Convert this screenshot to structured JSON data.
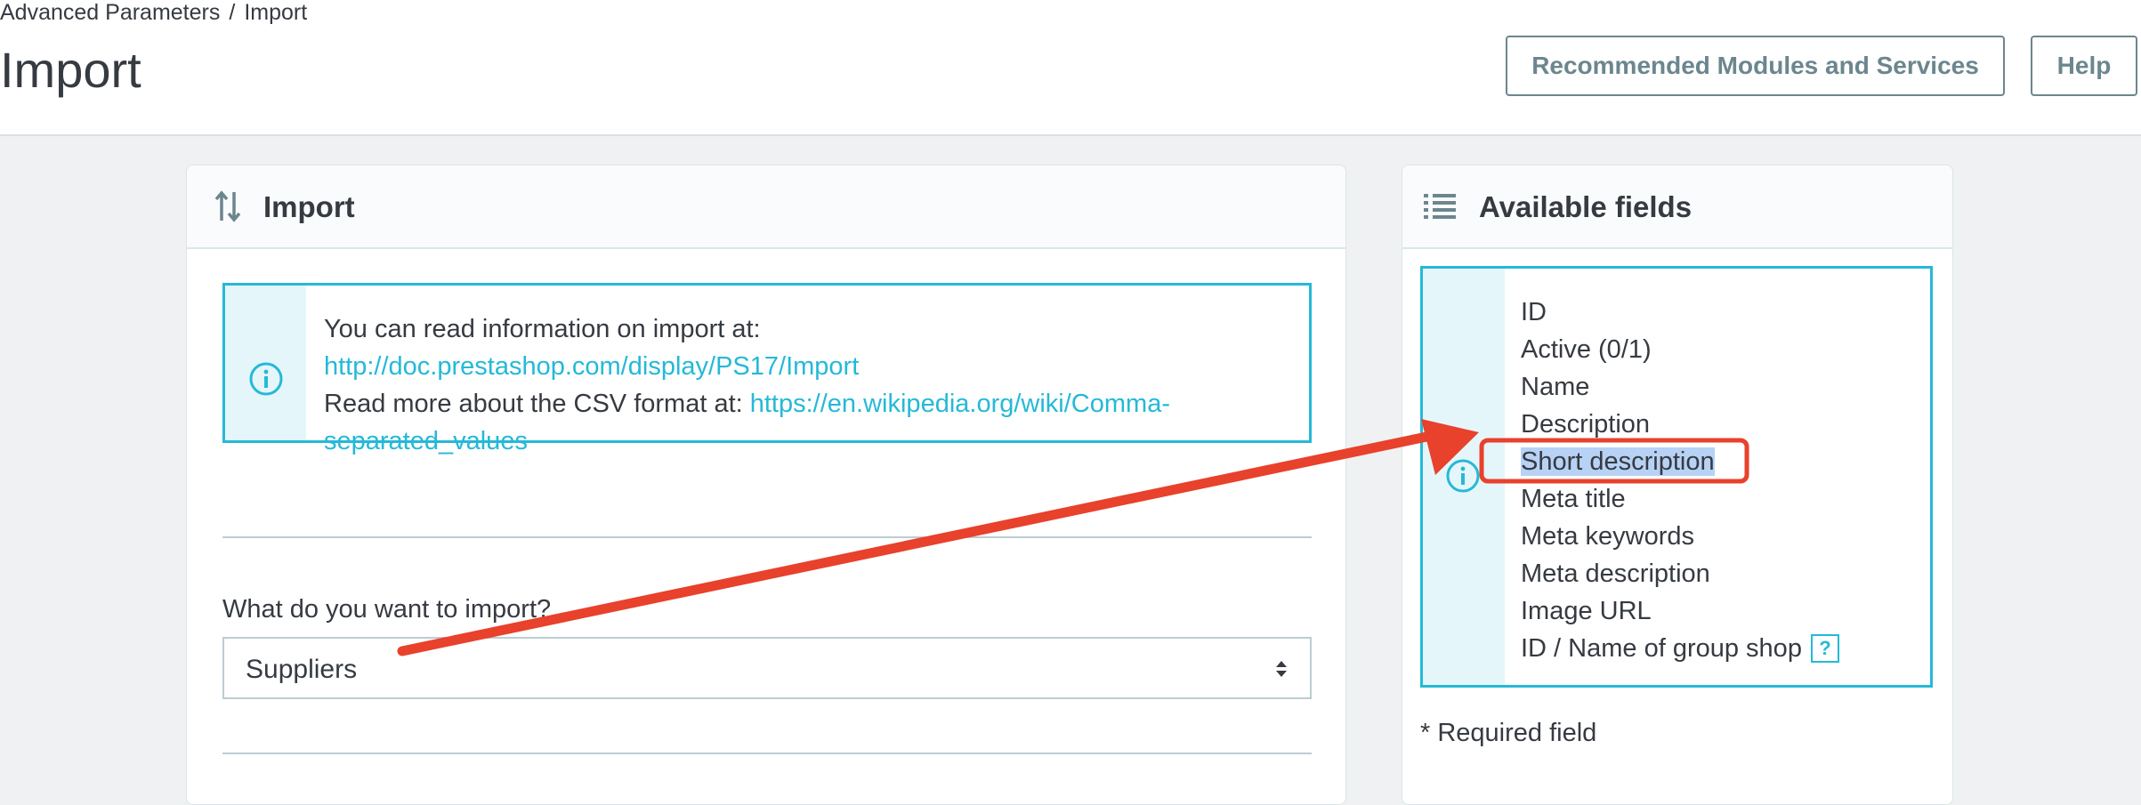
{
  "breadcrumb": {
    "parent": "Advanced Parameters",
    "separator": "/",
    "current": "Import"
  },
  "page_title": "Import",
  "toolbar": {
    "recommended_label": "Recommended Modules and Services",
    "help_label": "Help"
  },
  "import_panel": {
    "title": "Import",
    "info": {
      "line1": "You can read information on import at:",
      "link1": "http://doc.prestashop.com/display/PS17/Import",
      "line2": "Read more about the CSV format at:",
      "link2": "https://en.wikipedia.org/wiki/Comma-separated_values"
    },
    "question": "What do you want to import?",
    "selected_entity": "Suppliers"
  },
  "fields_panel": {
    "title": "Available fields",
    "fields": [
      "ID",
      "Active (0/1)",
      "Name",
      "Description",
      "Short description",
      "Meta title",
      "Meta keywords",
      "Meta description",
      "Image URL",
      "ID / Name of group shop"
    ],
    "help_mark": "?",
    "required_note": "* Required field"
  },
  "colors": {
    "accent": "#25b9d7",
    "annotation": "#e8412c",
    "selection": "#b7d2f5"
  }
}
